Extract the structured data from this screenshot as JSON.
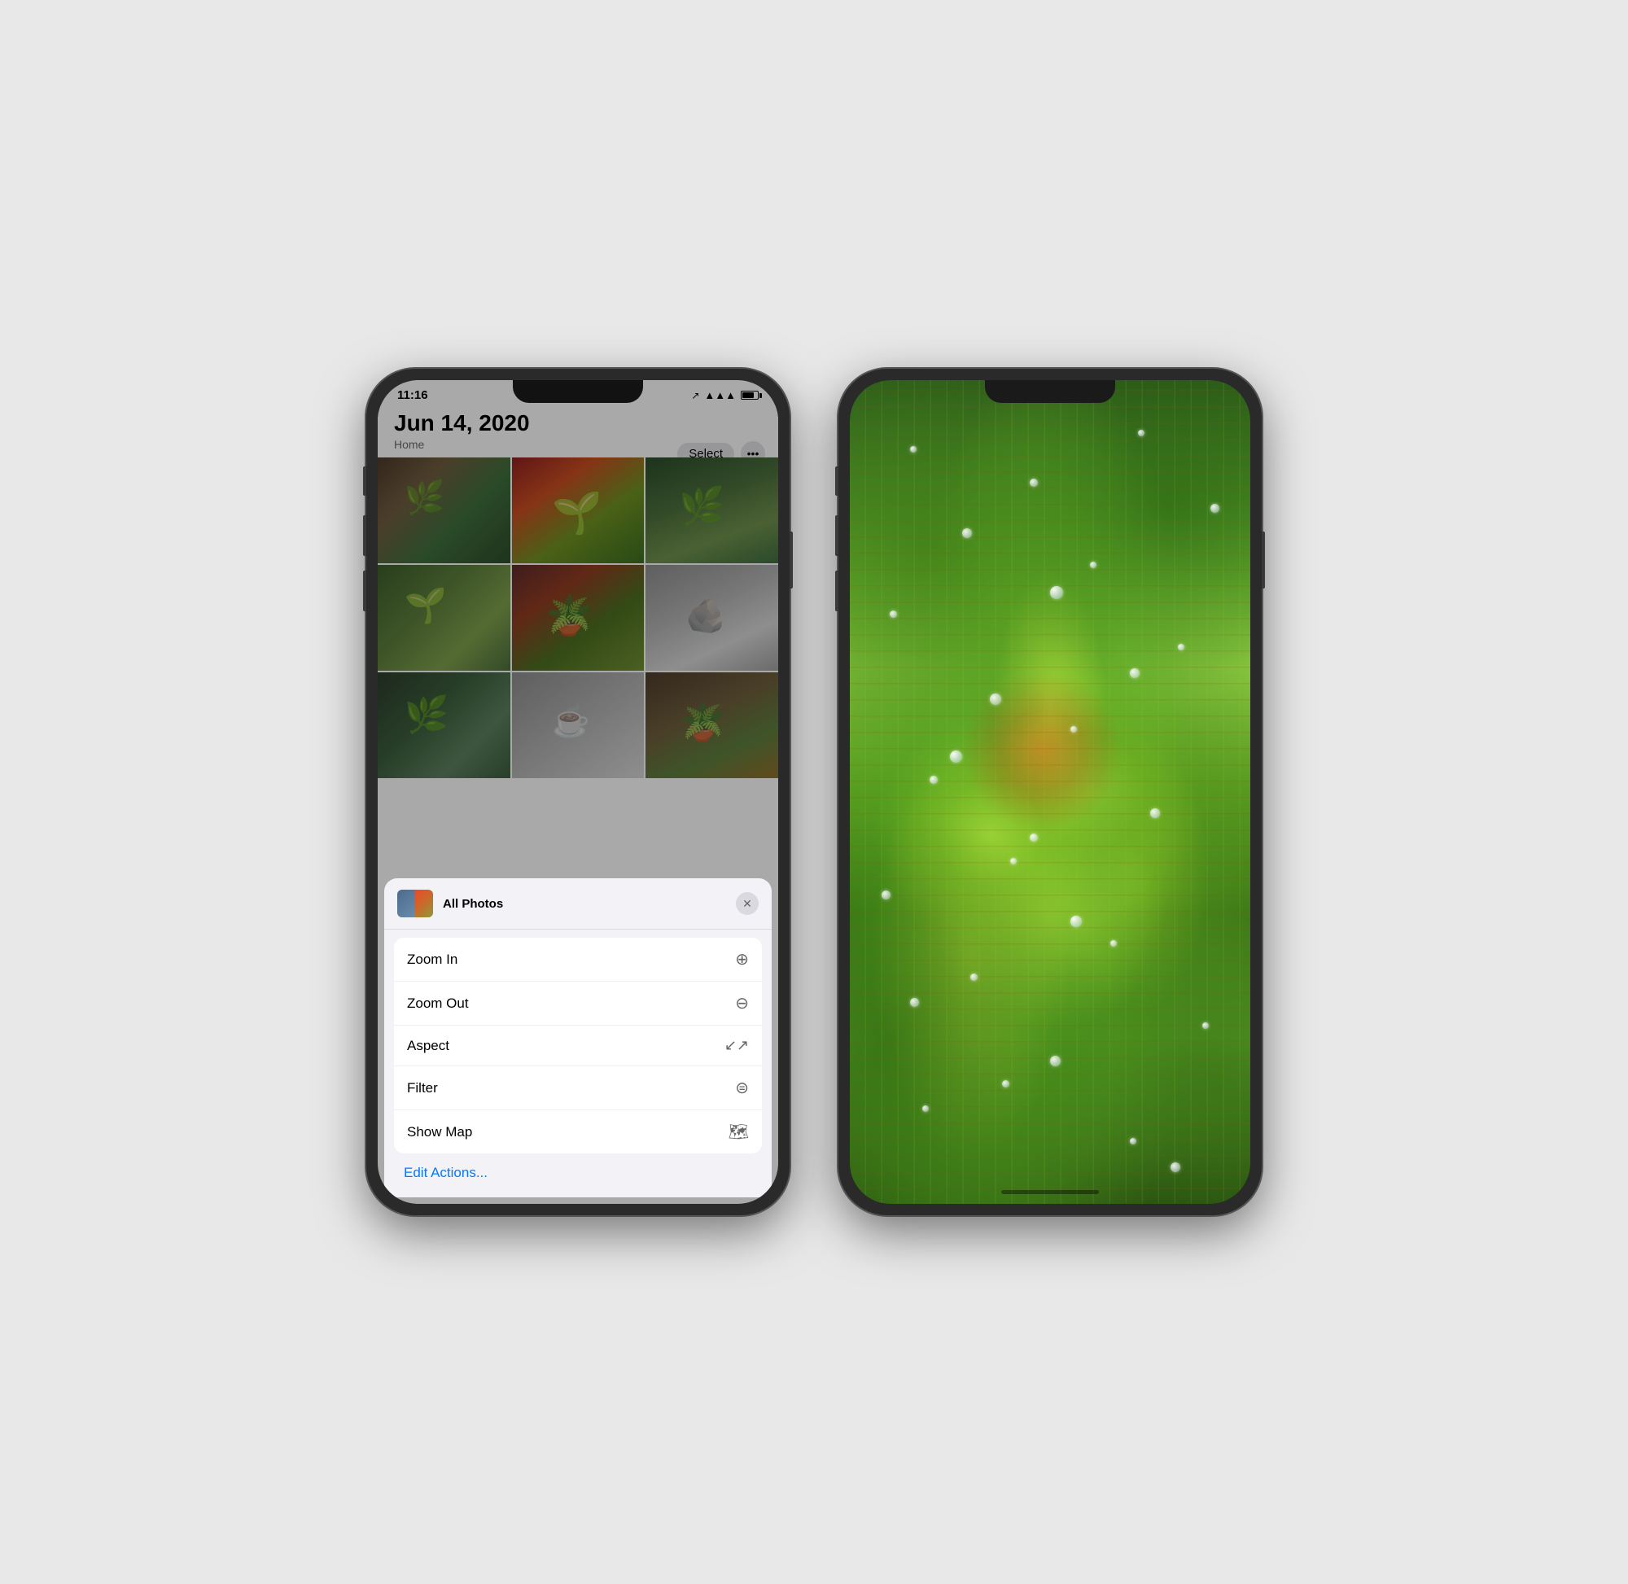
{
  "leftPhone": {
    "statusBar": {
      "time": "11:16",
      "locationArrow": "↗"
    },
    "header": {
      "date": "Jun 14, 2020",
      "subtitle": "Home",
      "selectButton": "Select",
      "moreButton": "•••"
    },
    "contextMenu": {
      "title": "All Photos",
      "closeButton": "×",
      "menuItems": [
        {
          "label": "Zoom In",
          "icon": "⊕"
        },
        {
          "label": "Zoom Out",
          "icon": "⊖"
        },
        {
          "label": "Aspect",
          "icon": "↙↗"
        },
        {
          "label": "Filter",
          "icon": "≡"
        },
        {
          "label": "Show Map",
          "icon": "🗺"
        }
      ],
      "editActions": "Edit Actions..."
    }
  },
  "rightPhone": {
    "description": "Close-up macro photo of a sundew (Drosera) carnivorous plant with red sticky tentacles and water droplets"
  }
}
